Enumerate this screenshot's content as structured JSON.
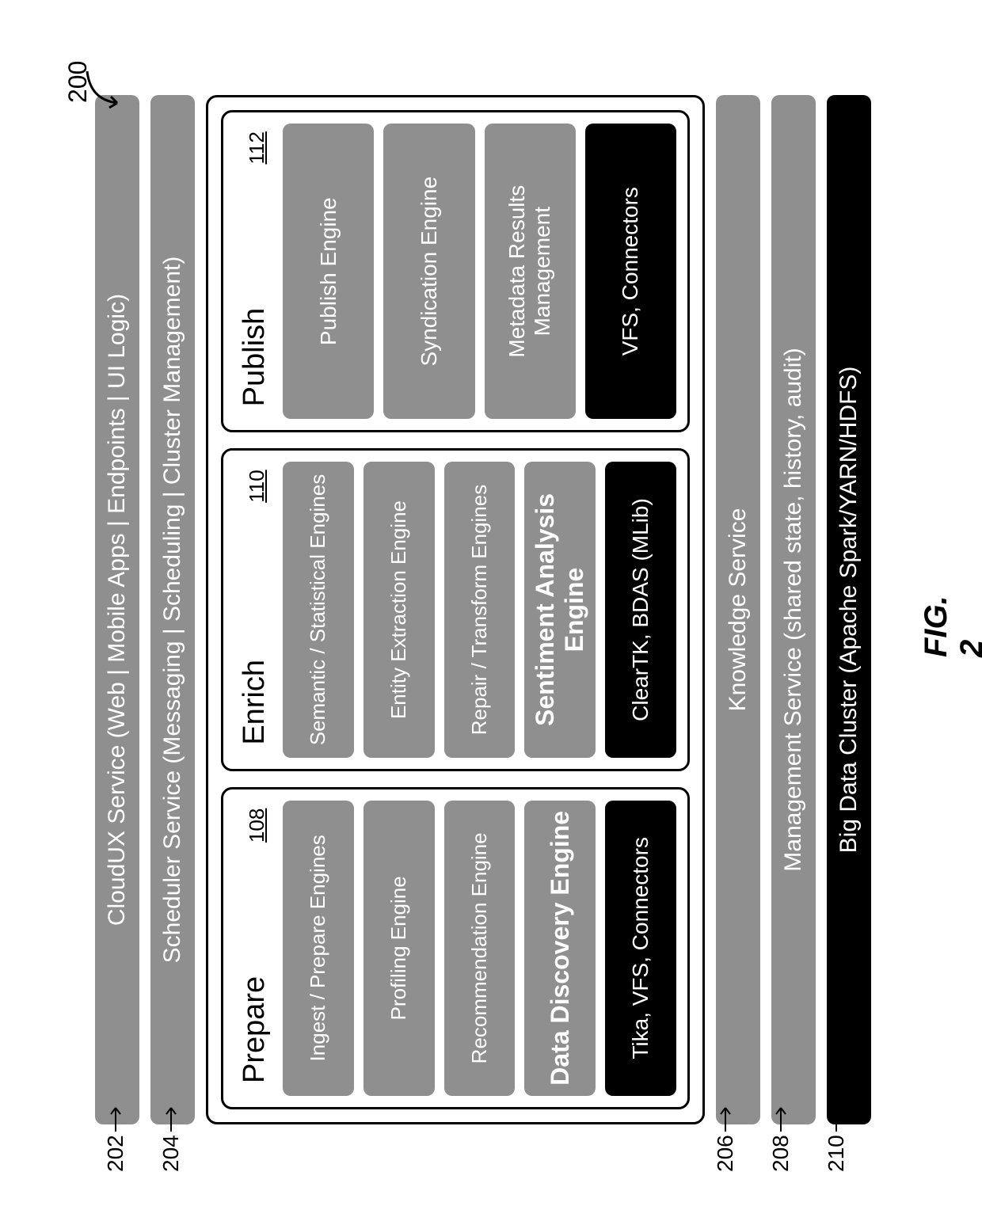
{
  "figure_label": "FIG. 2",
  "overall_ref": "200",
  "refs": {
    "r202": "202",
    "r204": "204",
    "r206": "206",
    "r208": "208",
    "r210": "210"
  },
  "bars": {
    "cloudux": "CloudUX Service (Web | Mobile Apps | Endpoints | UI Logic)",
    "scheduler": "Scheduler Service (Messaging | Scheduling | Cluster Management)",
    "knowledge": "Knowledge Service",
    "management": "Management Service (shared state, history, audit)",
    "bigdata": "Big Data Cluster (Apache Spark/YARN/HDFS)"
  },
  "columns": {
    "prepare": {
      "title": "Prepare",
      "ref": "108",
      "items": [
        "Ingest / Prepare Engines",
        "Profiling Engine",
        "Recommendation Engine"
      ],
      "bold_item": "Data Discovery Engine",
      "footer": "Tika, VFS, Connectors"
    },
    "enrich": {
      "title": "Enrich",
      "ref": "110",
      "items": [
        "Semantic / Statistical Engines",
        "Entity Extraction Engine",
        "Repair / Transform Engines"
      ],
      "bold_item": "Sentiment Analysis Engine",
      "footer": "ClearTK, BDAS (MLib)"
    },
    "publish": {
      "title": "Publish",
      "ref": "112",
      "items": [
        "Publish Engine",
        "Syndication Engine",
        "Metadata Results Management"
      ],
      "footer": "VFS, Connectors"
    }
  }
}
